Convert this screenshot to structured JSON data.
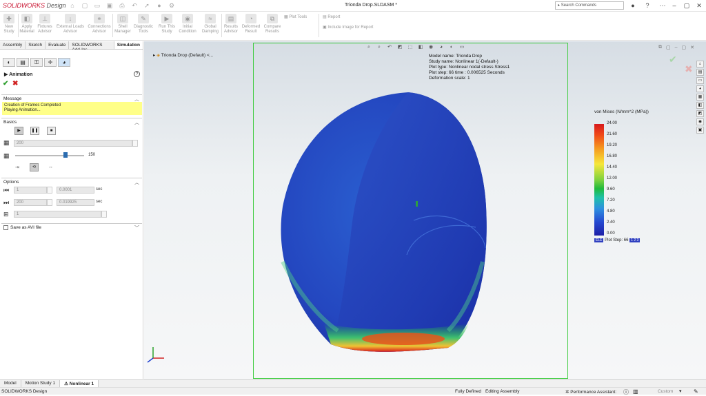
{
  "app": {
    "brand_bold": "SOLIDWORKS",
    "brand_rest": " Design",
    "document_title": "Trionda Drop.SLDASM *",
    "search_placeholder": "Search Commands"
  },
  "ribbon": {
    "buttons": [
      {
        "label": "New\nStudy",
        "icon": "new-study-icon"
      },
      {
        "label": "Apply\nMaterial",
        "icon": "material-icon"
      },
      {
        "label": "Fixtures\nAdvisor",
        "icon": "fixture-icon"
      },
      {
        "label": "External Loads\nAdvisor",
        "icon": "load-icon"
      },
      {
        "label": "Connections\nAdvisor",
        "icon": "connection-icon"
      },
      {
        "label": "Shell\nManager",
        "icon": "shell-icon"
      },
      {
        "label": "Diagnostic\nTools",
        "icon": "diagnostic-icon"
      },
      {
        "label": "Run This\nStudy",
        "icon": "run-icon"
      },
      {
        "label": "Initial\nCondition",
        "icon": "initial-icon"
      },
      {
        "label": "Global\nDamping",
        "icon": "damping-icon"
      },
      {
        "label": "Results\nAdvisor",
        "icon": "results-icon"
      },
      {
        "label": "Deformed\nResult",
        "icon": "deformed-icon"
      },
      {
        "label": "Compare\nResults",
        "icon": "compare-icon"
      }
    ],
    "plot_tools": "Plot Tools",
    "report": "Report",
    "include_image": "Include Image for Report"
  },
  "tabs": [
    "Assembly",
    "Sketch",
    "Evaluate",
    "SOLIDWORKS Add-Ins",
    "Simulation"
  ],
  "property_manager": {
    "title": "Animation",
    "message_header": "Message",
    "message_lines": [
      "Creation of Frames Completed",
      "Playing Animation..."
    ],
    "basics_header": "Basics",
    "frames_value": "200",
    "speed_value": "150",
    "speed_fraction": 0.73,
    "options_header": "Options",
    "start_value": "1",
    "start_time": "0.0001",
    "end_value": "200",
    "end_time": "0.019925",
    "step_value": "1",
    "unit": "sec",
    "save_avi": "Save as AVI file"
  },
  "tree": {
    "label": "Trionda Drop (Default) <..."
  },
  "model_info": [
    "Model name: Trionda Drop",
    "Study name: Nonlinear 1(-Default-)",
    "Plot type: Nonlinear nodal stress Stress1",
    "Plot step: 66   time : 0.006525 Seconds",
    "Deformation scale: 1"
  ],
  "legend": {
    "title": "von Mises (N/mm^2 (MPa))",
    "ticks": [
      "24.00",
      "21.60",
      "19.20",
      "16.80",
      "14.40",
      "12.00",
      "9.60",
      "7.20",
      "4.80",
      "2.40",
      "0.00"
    ],
    "plot_step_label": "Plot Step: 66",
    "badge_left": "ELE",
    "badge_right": "1 2 3"
  },
  "bottom_tabs": [
    "Model",
    "Motion Study 1",
    "Nonlinear 1"
  ],
  "status": {
    "left": "SOLIDWORKS Design",
    "defined": "Fully Defined",
    "mode": "Editing Assembly",
    "assistant": "Performance Assistant:",
    "custom": "Custom"
  }
}
